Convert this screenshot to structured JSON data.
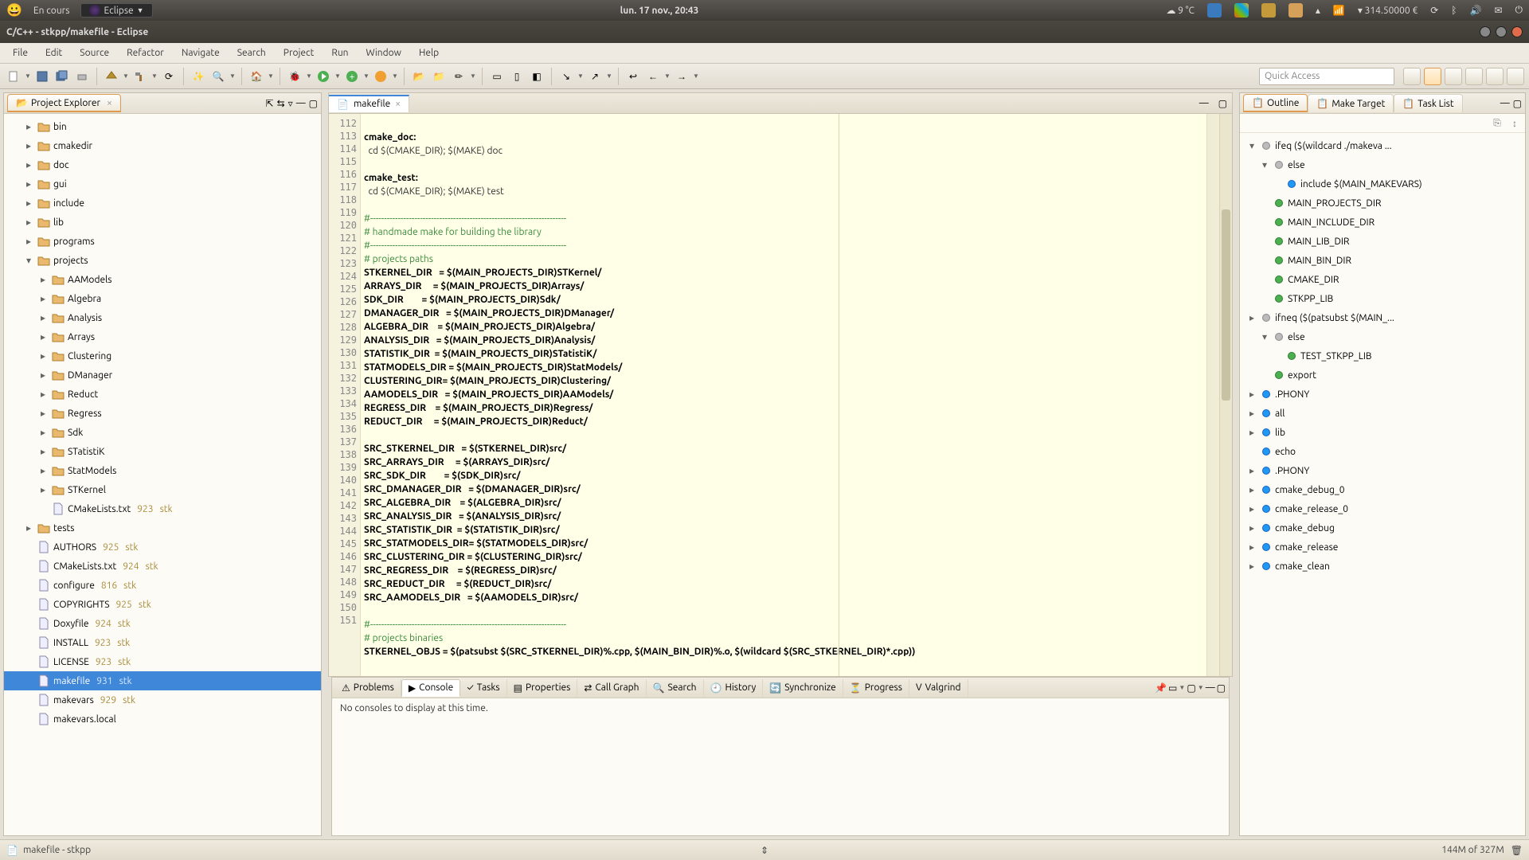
{
  "sysbar": {
    "task": "En cours",
    "app": "Eclipse",
    "date": "lun. 17 nov., 20:43",
    "weather": "9 °C",
    "battery": "314.50000 €"
  },
  "title": "C/C++ - stkpp/makefile - Eclipse",
  "menu": [
    "File",
    "Edit",
    "Source",
    "Refactor",
    "Navigate",
    "Search",
    "Project",
    "Run",
    "Window",
    "Help"
  ],
  "quick_access_placeholder": "Quick Access",
  "project_explorer": {
    "title": "Project Explorer",
    "items": [
      {
        "d": 1,
        "tw": "+",
        "icon": "folder",
        "label": "bin"
      },
      {
        "d": 1,
        "tw": "+",
        "icon": "folder",
        "label": "cmakedir"
      },
      {
        "d": 1,
        "tw": "+",
        "icon": "folder",
        "label": "doc"
      },
      {
        "d": 1,
        "tw": "+",
        "icon": "folder",
        "label": "gui"
      },
      {
        "d": 1,
        "tw": "+",
        "icon": "folder",
        "label": "include"
      },
      {
        "d": 1,
        "tw": "+",
        "icon": "folder",
        "label": "lib"
      },
      {
        "d": 1,
        "tw": "+",
        "icon": "folder",
        "label": "programs"
      },
      {
        "d": 1,
        "tw": "-",
        "icon": "folder",
        "label": "projects"
      },
      {
        "d": 2,
        "tw": "+",
        "icon": "folder",
        "label": "AAModels"
      },
      {
        "d": 2,
        "tw": "+",
        "icon": "folder",
        "label": "Algebra"
      },
      {
        "d": 2,
        "tw": "+",
        "icon": "folder",
        "label": "Analysis"
      },
      {
        "d": 2,
        "tw": "+",
        "icon": "folder",
        "label": "Arrays"
      },
      {
        "d": 2,
        "tw": "+",
        "icon": "folder",
        "label": "Clustering"
      },
      {
        "d": 2,
        "tw": "+",
        "icon": "folder",
        "label": "DManager"
      },
      {
        "d": 2,
        "tw": "+",
        "icon": "folder",
        "label": "Reduct"
      },
      {
        "d": 2,
        "tw": "+",
        "icon": "folder",
        "label": "Regress"
      },
      {
        "d": 2,
        "tw": "+",
        "icon": "folder",
        "label": "Sdk"
      },
      {
        "d": 2,
        "tw": "+",
        "icon": "folder",
        "label": "STatistiK"
      },
      {
        "d": 2,
        "tw": "+",
        "icon": "folder",
        "label": "StatModels"
      },
      {
        "d": 2,
        "tw": "+",
        "icon": "folder",
        "label": "STKernel"
      },
      {
        "d": 2,
        "tw": "",
        "icon": "file",
        "label": "CMakeLists.txt",
        "rev": "923",
        "auth": "stk"
      },
      {
        "d": 1,
        "tw": "+",
        "icon": "folder",
        "label": "tests"
      },
      {
        "d": 1,
        "tw": "",
        "icon": "file",
        "label": "AUTHORS",
        "rev": "925",
        "auth": "stk"
      },
      {
        "d": 1,
        "tw": "",
        "icon": "file",
        "label": "CMakeLists.txt",
        "rev": "924",
        "auth": "stk"
      },
      {
        "d": 1,
        "tw": "",
        "icon": "file",
        "label": "configure",
        "rev": "816",
        "auth": "stk"
      },
      {
        "d": 1,
        "tw": "",
        "icon": "file",
        "label": "COPYRIGHTS",
        "rev": "925",
        "auth": "stk"
      },
      {
        "d": 1,
        "tw": "",
        "icon": "file",
        "label": "Doxyfile",
        "rev": "924",
        "auth": "stk"
      },
      {
        "d": 1,
        "tw": "",
        "icon": "file",
        "label": "INSTALL",
        "rev": "923",
        "auth": "stk"
      },
      {
        "d": 1,
        "tw": "",
        "icon": "file",
        "label": "LICENSE",
        "rev": "923",
        "auth": "stk"
      },
      {
        "d": 1,
        "tw": "",
        "icon": "file",
        "label": "makefile",
        "rev": "931",
        "auth": "stk",
        "sel": true
      },
      {
        "d": 1,
        "tw": "",
        "icon": "file",
        "label": "makevars",
        "rev": "929",
        "auth": "stk"
      },
      {
        "d": 1,
        "tw": "",
        "icon": "file",
        "label": "makevars.local"
      }
    ]
  },
  "editor": {
    "tab": "makefile",
    "first_line": 112,
    "lines": [
      {
        "t": ""
      },
      {
        "t": "cmake_doc:",
        "cls": "kw"
      },
      {
        "t": "  cd $(CMAKE_DIR); $(MAKE) doc"
      },
      {
        "t": ""
      },
      {
        "t": "cmake_test:",
        "cls": "kw"
      },
      {
        "t": "  cd $(CMAKE_DIR); $(MAKE) test"
      },
      {
        "t": ""
      },
      {
        "t": "#-----------------------------------------------------------------------",
        "cls": "cm"
      },
      {
        "t": "# handmade make for building the library",
        "cls": "cm"
      },
      {
        "t": "#-----------------------------------------------------------------------",
        "cls": "cm"
      },
      {
        "t": "# projects paths",
        "cls": "cm"
      },
      {
        "t": "STKERNEL_DIR   = $(MAIN_PROJECTS_DIR)STKernel/",
        "cls": "kw"
      },
      {
        "t": "ARRAYS_DIR     = $(MAIN_PROJECTS_DIR)Arrays/",
        "cls": "kw"
      },
      {
        "t": "SDK_DIR        = $(MAIN_PROJECTS_DIR)Sdk/",
        "cls": "kw"
      },
      {
        "t": "DMANAGER_DIR   = $(MAIN_PROJECTS_DIR)DManager/",
        "cls": "kw"
      },
      {
        "t": "ALGEBRA_DIR    = $(MAIN_PROJECTS_DIR)Algebra/",
        "cls": "kw"
      },
      {
        "t": "ANALYSIS_DIR   = $(MAIN_PROJECTS_DIR)Analysis/",
        "cls": "kw"
      },
      {
        "t": "STATISTIK_DIR  = $(MAIN_PROJECTS_DIR)STatistiK/",
        "cls": "kw"
      },
      {
        "t": "STATMODELS_DIR = $(MAIN_PROJECTS_DIR)StatModels/",
        "cls": "kw"
      },
      {
        "t": "CLUSTERING_DIR= $(MAIN_PROJECTS_DIR)Clustering/",
        "cls": "kw"
      },
      {
        "t": "AAMODELS_DIR   = $(MAIN_PROJECTS_DIR)AAModels/",
        "cls": "kw"
      },
      {
        "t": "REGRESS_DIR    = $(MAIN_PROJECTS_DIR)Regress/",
        "cls": "kw"
      },
      {
        "t": "REDUCT_DIR     = $(MAIN_PROJECTS_DIR)Reduct/",
        "cls": "kw"
      },
      {
        "t": ""
      },
      {
        "t": "SRC_STKERNEL_DIR   = $(STKERNEL_DIR)src/",
        "cls": "kw"
      },
      {
        "t": "SRC_ARRAYS_DIR     = $(ARRAYS_DIR)src/",
        "cls": "kw"
      },
      {
        "t": "SRC_SDK_DIR        = $(SDK_DIR)src/",
        "cls": "kw"
      },
      {
        "t": "SRC_DMANAGER_DIR   = $(DMANAGER_DIR)src/",
        "cls": "kw"
      },
      {
        "t": "SRC_ALGEBRA_DIR    = $(ALGEBRA_DIR)src/",
        "cls": "kw"
      },
      {
        "t": "SRC_ANALYSIS_DIR   = $(ANALYSIS_DIR)src/",
        "cls": "kw"
      },
      {
        "t": "SRC_STATISTIK_DIR  = $(STATISTIK_DIR)src/",
        "cls": "kw"
      },
      {
        "t": "SRC_STATMODELS_DIR= $(STATMODELS_DIR)src/",
        "cls": "kw"
      },
      {
        "t": "SRC_CLUSTERING_DIR = $(CLUSTERING_DIR)src/",
        "cls": "kw"
      },
      {
        "t": "SRC_REGRESS_DIR    = $(REGRESS_DIR)src/",
        "cls": "kw"
      },
      {
        "t": "SRC_REDUCT_DIR     = $(REDUCT_DIR)src/",
        "cls": "kw"
      },
      {
        "t": "SRC_AAMODELS_DIR   = $(AAMODELS_DIR)src/",
        "cls": "kw"
      },
      {
        "t": ""
      },
      {
        "t": "#-----------------------------------------------------------------------",
        "cls": "cm"
      },
      {
        "t": "# projects binaries",
        "cls": "cm"
      },
      {
        "t": "STKERNEL_OBJS = $(patsubst $(SRC_STKERNEL_DIR)%.cpp, $(MAIN_BIN_DIR)%.o, $(wildcard $(SRC_STKERNEL_DIR)*.cpp))",
        "cls": "kw"
      }
    ]
  },
  "outline": {
    "tabs": [
      "Outline",
      "Make Target",
      "Task List"
    ],
    "items": [
      {
        "tw": "-",
        "c": "gray",
        "label": "ifeq ($(wildcard ./makeva ..."
      },
      {
        "tw": "-",
        "c": "gray",
        "label": "else",
        "d": 1
      },
      {
        "tw": "",
        "c": "blue",
        "label": "include $(MAIN_MAKEVARS)",
        "d": 2
      },
      {
        "tw": "",
        "c": "green",
        "label": "MAIN_PROJECTS_DIR",
        "d": 1
      },
      {
        "tw": "",
        "c": "green",
        "label": "MAIN_INCLUDE_DIR",
        "d": 1
      },
      {
        "tw": "",
        "c": "green",
        "label": "MAIN_LIB_DIR",
        "d": 1
      },
      {
        "tw": "",
        "c": "green",
        "label": "MAIN_BIN_DIR",
        "d": 1
      },
      {
        "tw": "",
        "c": "green",
        "label": "CMAKE_DIR",
        "d": 1
      },
      {
        "tw": "",
        "c": "green",
        "label": "STKPP_LIB",
        "d": 1
      },
      {
        "tw": "+",
        "c": "gray",
        "label": "ifneq ($(patsubst $(MAIN_..."
      },
      {
        "tw": "-",
        "c": "gray",
        "label": "else",
        "d": 1
      },
      {
        "tw": "",
        "c": "green",
        "label": "TEST_STKPP_LIB",
        "d": 2
      },
      {
        "tw": "",
        "c": "green",
        "label": "export",
        "d": 1
      },
      {
        "tw": "+",
        "c": "blue",
        "label": ".PHONY"
      },
      {
        "tw": "+",
        "c": "blue",
        "label": "all"
      },
      {
        "tw": "+",
        "c": "blue",
        "label": "lib"
      },
      {
        "tw": "",
        "c": "blue",
        "label": "echo"
      },
      {
        "tw": "+",
        "c": "blue",
        "label": ".PHONY"
      },
      {
        "tw": "+",
        "c": "blue",
        "label": "cmake_debug_0"
      },
      {
        "tw": "+",
        "c": "blue",
        "label": "cmake_release_0"
      },
      {
        "tw": "+",
        "c": "blue",
        "label": "cmake_debug"
      },
      {
        "tw": "+",
        "c": "blue",
        "label": "cmake_release"
      },
      {
        "tw": "+",
        "c": "blue",
        "label": "cmake_clean"
      }
    ]
  },
  "bottom": {
    "tabs": [
      "Problems",
      "Console",
      "Tasks",
      "Properties",
      "Call Graph",
      "Search",
      "History",
      "Synchronize",
      "Progress",
      "Valgrind"
    ],
    "active": "Console",
    "message": "No consoles to display at this time."
  },
  "status": {
    "left": "makefile - stkpp",
    "mem": "144M of 327M"
  }
}
